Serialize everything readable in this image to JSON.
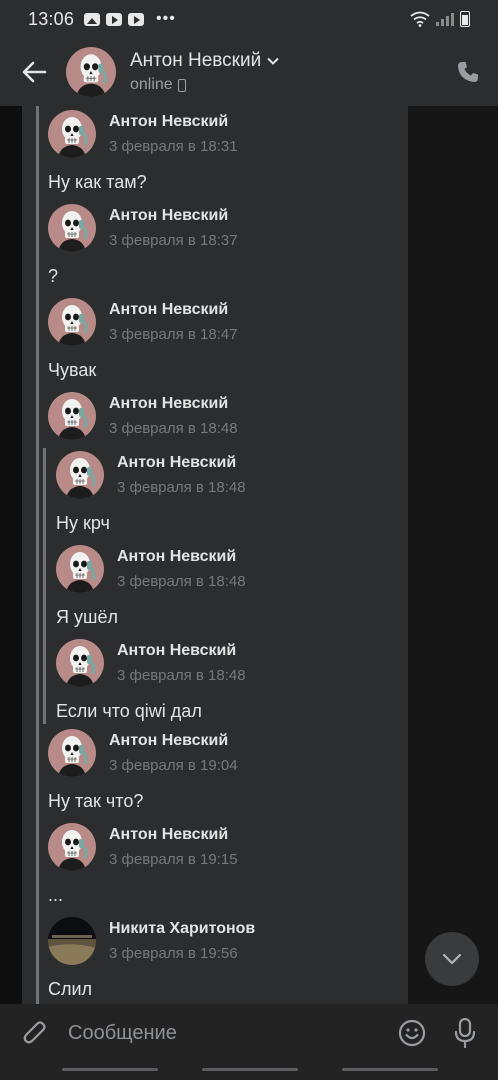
{
  "status_bar": {
    "time": "13:06",
    "dots": "•••"
  },
  "header": {
    "name": "Антон Невский",
    "status": "online",
    "icons": [
      "back-arrow-icon",
      "chevron-down-icon",
      "mobile-device-icon",
      "phone-call-icon"
    ]
  },
  "messages": [
    {
      "name": "Антон Невский",
      "date": "3 февраля в 18:31",
      "text": "Ну как там?"
    },
    {
      "name": "Антон Невский",
      "date": "3 февраля в 18:37",
      "text": "?"
    },
    {
      "name": "Антон Невский",
      "date": "3 февраля в 18:47",
      "text": "Чувак"
    },
    {
      "name": "Антон Невский",
      "date": "3 февраля в 18:48",
      "text": ""
    },
    {
      "name": "Антон Невский",
      "date": "3 февраля в 18:48",
      "text": "Ну крч"
    },
    {
      "name": "Антон Невский",
      "date": "3 февраля в 18:48",
      "text": "Я ушёл"
    },
    {
      "name": "Антон Невский",
      "date": "3 февраля в 18:48",
      "text": "Если что qiwi дал"
    },
    {
      "name": "Антон Невский",
      "date": "3 февраля в 19:04",
      "text": "Ну так что?"
    },
    {
      "name": "Антон Невский",
      "date": "3 февраля в 19:15",
      "text": "..."
    },
    {
      "name": "Никита Харитонов",
      "date": "3 февраля в 19:56",
      "text": "Слил"
    }
  ],
  "composer": {
    "placeholder": "Сообщение",
    "icons": [
      "paperclip-icon",
      "emoji-icon",
      "microphone-icon"
    ]
  },
  "colors": {
    "bubble": "#2c2d2e",
    "header": "#2c2d2e",
    "date_text": "#76787a",
    "avatar_bg": "#b58a8a"
  }
}
